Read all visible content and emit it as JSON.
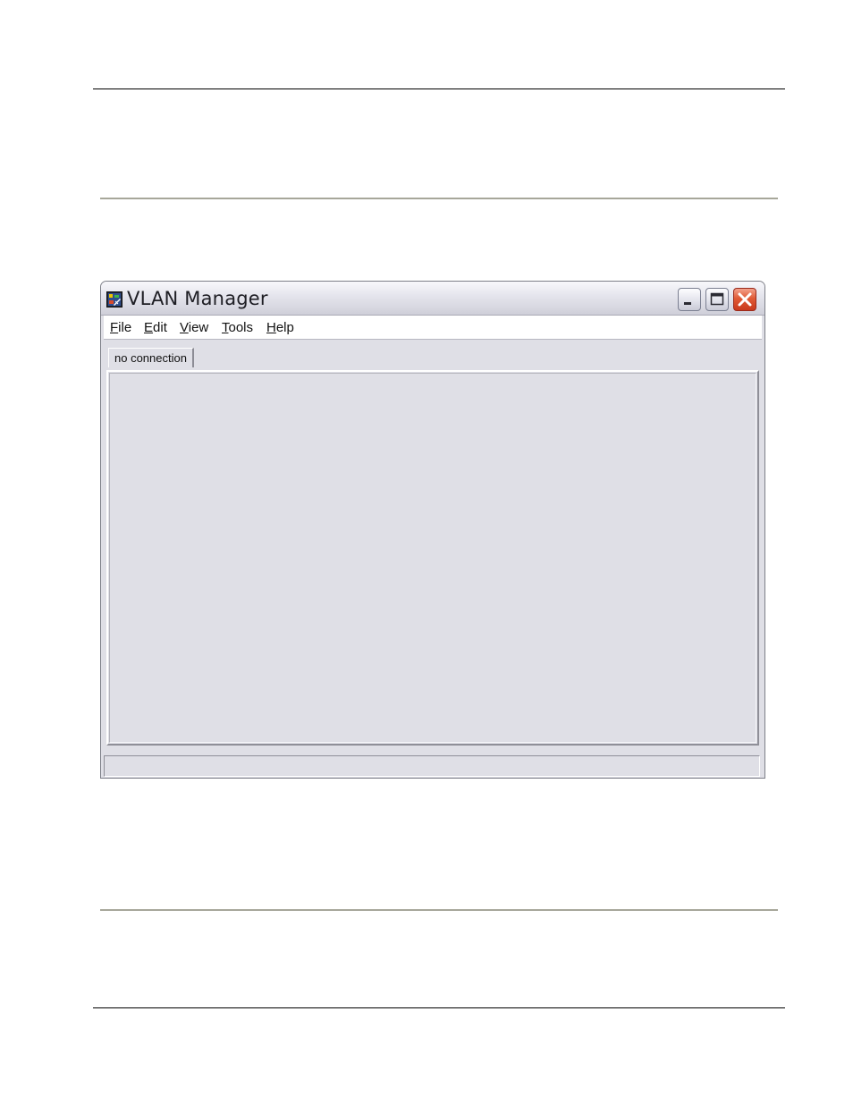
{
  "window": {
    "title": "VLAN Manager",
    "icon": "vlan-manager-app-icon"
  },
  "titlebar_buttons": {
    "minimize_icon": "minimize-icon",
    "maximize_icon": "maximize-icon",
    "close_icon": "close-icon"
  },
  "menu": {
    "items": [
      {
        "mnemonic": "F",
        "rest": "ile"
      },
      {
        "mnemonic": "E",
        "rest": "dit"
      },
      {
        "mnemonic": "V",
        "rest": "iew"
      },
      {
        "mnemonic": "T",
        "rest": "ools"
      },
      {
        "mnemonic": "H",
        "rest": "elp"
      }
    ]
  },
  "tabs": [
    {
      "label": "no connection"
    }
  ],
  "statusbar": {
    "text": ""
  },
  "colors": {
    "window_bg": "#dfdfe6",
    "close_button": "#e05a35",
    "rule": "#a7a79a"
  }
}
